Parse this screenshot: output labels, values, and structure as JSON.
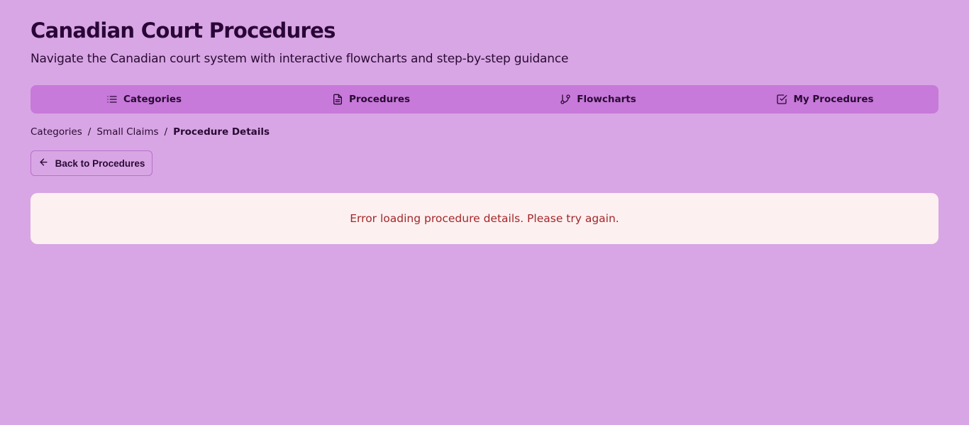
{
  "header": {
    "title": "Canadian Court Procedures",
    "subtitle": "Navigate the Canadian court system with interactive flowcharts and step-by-step guidance"
  },
  "nav": {
    "tabs": [
      {
        "label": "Categories",
        "icon": "list-icon"
      },
      {
        "label": "Procedures",
        "icon": "document-icon"
      },
      {
        "label": "Flowcharts",
        "icon": "git-branch-icon"
      },
      {
        "label": "My Procedures",
        "icon": "checkbox-icon"
      }
    ]
  },
  "breadcrumb": {
    "items": [
      "Categories",
      "Small Claims",
      "Procedure Details"
    ],
    "separator": "/"
  },
  "back_button": {
    "label": "Back to Procedures",
    "icon": "arrow-left-icon"
  },
  "error": {
    "message": "Error loading procedure details. Please try again."
  },
  "colors": {
    "background": "#d8a6e4",
    "nav_background": "#c77ad9",
    "error_background": "#fdf0f0",
    "error_text": "#a3282a",
    "text": "#2a0a35"
  }
}
